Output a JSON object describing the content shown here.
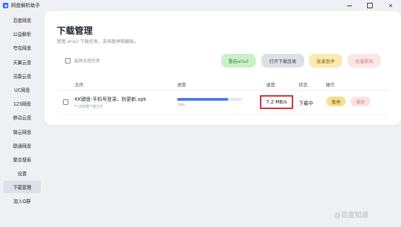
{
  "window": {
    "title": "网盘解析助手",
    "controls": [
      "minimize",
      "maximize",
      "close"
    ],
    "close_symbol": "✕"
  },
  "sidebar": {
    "items": [
      {
        "label": "百度网盘"
      },
      {
        "label": "公益解析"
      },
      {
        "label": "夸克网盘"
      },
      {
        "label": "天翼云盘"
      },
      {
        "label": "迅雷云盘"
      },
      {
        "label": "UC网盘"
      },
      {
        "label": "123网盘"
      },
      {
        "label": "移动云盘"
      },
      {
        "label": "微云网盘"
      },
      {
        "label": "联通网盘"
      },
      {
        "label": "聚合搜索"
      },
      {
        "label": "设置"
      },
      {
        "label": "下载管理",
        "active": true
      },
      {
        "label": "加入Q群"
      }
    ]
  },
  "main": {
    "title": "下载管理",
    "subtitle": "管理 aria2 下载任务，支持暂停和删除。",
    "select_all_label": "选择全部任务",
    "buttons": {
      "restart": "重启aria2",
      "open_dir": "打开下载目录",
      "pause_all": "批量暂停",
      "delete_all": "批量删除"
    },
    "columns": {
      "file": "文件",
      "progress": "进度",
      "speed": "速度",
      "status": "状态",
      "actions": "操作"
    },
    "rows": [
      {
        "file_name": "KK键盘-手机号登录，别更新.apk",
        "file_path": "F:\\浏览器下载文件",
        "progress_percent": 79,
        "progress_text": "79%",
        "speed": "7.2 MB/s",
        "status": "下载中",
        "pause_label": "暂停",
        "delete_label": "删除"
      }
    ]
  },
  "watermark": "@百度知道",
  "colors": {
    "accent": "#4b7be5",
    "highlight_border": "#d8262b",
    "restart_bg": "#c9f0c9",
    "pause_bg": "#f6df8e",
    "delete_bg": "#fbe2e2"
  }
}
